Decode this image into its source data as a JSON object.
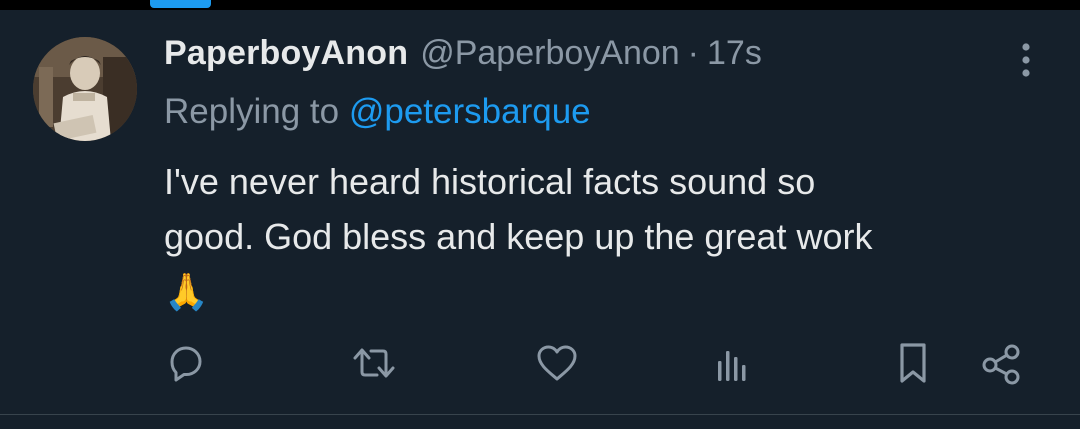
{
  "tweet": {
    "author_name": "PaperboyAnon",
    "author_handle": "@PaperboyAnon",
    "separator": "·",
    "timestamp": "17s",
    "replying_prefix": "Replying to",
    "replying_to": "@petersbarque",
    "body_lines": [
      "I've never heard historical facts sound so",
      "good. God bless and keep up the great work"
    ],
    "emoji": "🙏"
  },
  "icons": {
    "more": "more-vertical-icon",
    "reply": "reply-icon",
    "retweet": "retweet-icon",
    "like": "like-icon",
    "views": "views-icon",
    "bookmark": "bookmark-icon",
    "share": "share-icon"
  },
  "colors": {
    "background": "#15202b",
    "primary_text": "#e7e9ea",
    "secondary_text": "#8b98a5",
    "accent": "#1d9bf0"
  }
}
